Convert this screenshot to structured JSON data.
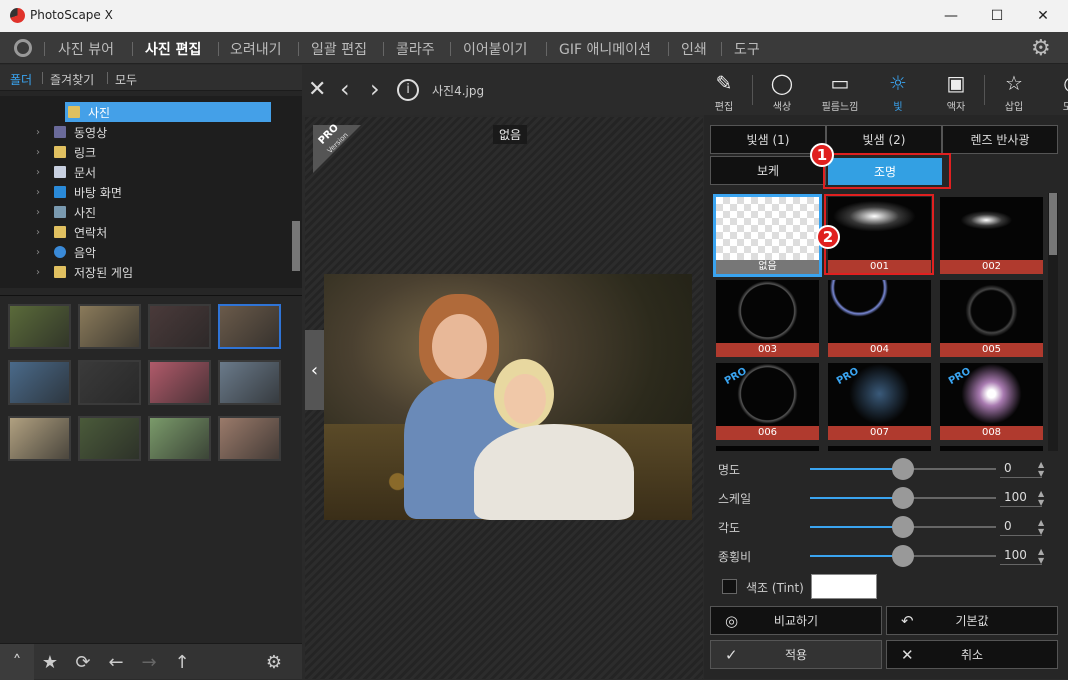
{
  "app": {
    "title": "PhotoScape X"
  },
  "window": {
    "minimize": "—",
    "maximize": "☐",
    "close": "✕"
  },
  "menu": {
    "items": [
      "사진 뷰어",
      "사진 편집",
      "오려내기",
      "일괄 편집",
      "콜라주",
      "이어붙이기",
      "GIF 애니메이션",
      "인쇄",
      "도구"
    ],
    "active": "사진 편집"
  },
  "left": {
    "tabs": [
      "폴더",
      "즐겨찾기",
      "모두"
    ],
    "tree": [
      {
        "label": "사진",
        "selected": true,
        "icon": "folder-icon"
      },
      {
        "label": "동영상",
        "icon": "video-folder-icon"
      },
      {
        "label": "링크",
        "icon": "link-folder-icon"
      },
      {
        "label": "문서",
        "icon": "document-folder-icon"
      },
      {
        "label": "바탕 화면",
        "icon": "desktop-folder-icon"
      },
      {
        "label": "사진",
        "icon": "pictures-folder-icon"
      },
      {
        "label": "연락처",
        "icon": "contacts-folder-icon"
      },
      {
        "label": "음악",
        "icon": "music-folder-icon"
      },
      {
        "label": "저장된 게임",
        "icon": "saved-games-folder-icon"
      }
    ],
    "thumbnail_colors": [
      "#5a6a3a",
      "#8a7a5a",
      "#4a3a3a",
      "#6a5a4a",
      "#4a6a8a",
      "#3a3a3a",
      "#b05a6a",
      "#6a7a8a",
      "#b0a080",
      "#4a5a3a",
      "#7a9a6a",
      "#9a7a6a"
    ],
    "selected_thumbnail": 3
  },
  "center": {
    "filename": "사진4.jpg",
    "overlay_label": "없음",
    "pro_badge": "PRO",
    "pro_sub": "Version"
  },
  "right": {
    "tools": [
      {
        "label": "편집",
        "icon": "edit-icon"
      },
      {
        "label": "색상",
        "icon": "color-circle-icon"
      },
      {
        "label": "필름느낌",
        "icon": "film-icon"
      },
      {
        "label": "빛",
        "icon": "light-icon",
        "active": true
      },
      {
        "label": "액자",
        "icon": "frame-icon"
      },
      {
        "label": "삽입",
        "icon": "insert-icon"
      },
      {
        "label": "도구",
        "icon": "palette-icon"
      }
    ],
    "tabs_row1": [
      "빛샘 (1)",
      "빛샘 (2)",
      "렌즈 반사광"
    ],
    "tabs_row2": [
      "보케",
      "조명"
    ],
    "active_tab": "조명",
    "grid": [
      {
        "label": "없음",
        "type": "none",
        "selected": true
      },
      {
        "label": "001",
        "type": "spot"
      },
      {
        "label": "002",
        "type": "spot2"
      },
      {
        "label": "003",
        "type": "ring"
      },
      {
        "label": "004",
        "type": "arc"
      },
      {
        "label": "005",
        "type": "dots"
      },
      {
        "label": "006",
        "type": "ring",
        "pro": true
      },
      {
        "label": "007",
        "type": "glow",
        "pro": true
      },
      {
        "label": "008",
        "type": "bright",
        "pro": true
      }
    ],
    "pro_text": "PRO",
    "sliders": [
      {
        "label": "명도",
        "value": "0",
        "fraction": 0.5
      },
      {
        "label": "스케일",
        "value": "100",
        "fraction": 0.5
      },
      {
        "label": "각도",
        "value": "0",
        "fraction": 0.5
      },
      {
        "label": "종횡비",
        "value": "100",
        "fraction": 0.5
      }
    ],
    "tint_label": "색조 (Tint)",
    "buttons": {
      "compare": "비교하기",
      "default": "기본값",
      "apply": "적용",
      "cancel": "취소"
    },
    "annotations": [
      "1",
      "2"
    ]
  },
  "colors": {
    "accent": "#33a0e3",
    "red": "#e0201f",
    "label_red": "#b03a2e"
  }
}
